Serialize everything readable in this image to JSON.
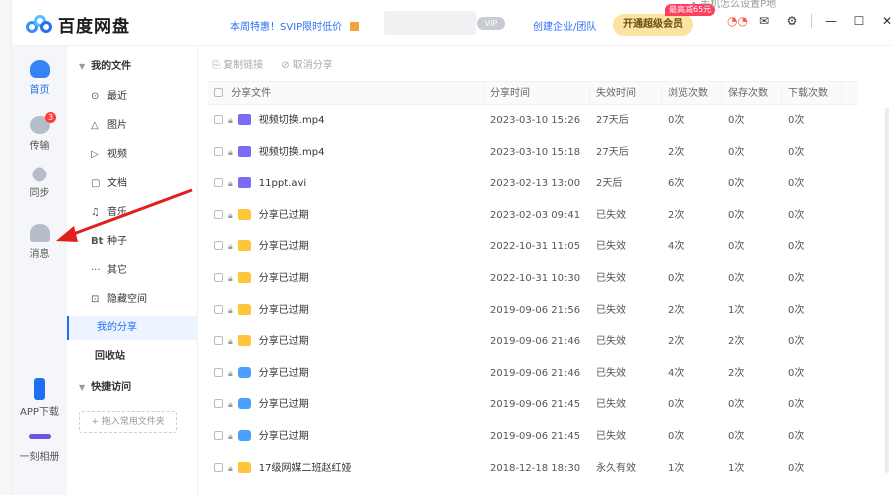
{
  "app": {
    "title": "百度网盘"
  },
  "header": {
    "promo": "本周特惠！SVIP限时低价",
    "vip_badge": "VIP",
    "enterprise": "创建企业/团队",
    "open_vip": "开通超级会员",
    "discount": "最高减65元",
    "hint": "• 手机怎么设置P地",
    "icons": [
      "game-icon",
      "mail-icon",
      "settings-icon",
      "minimize-icon",
      "maximize-icon",
      "close-icon"
    ]
  },
  "rail": [
    {
      "label": "首页",
      "icon": "home-icon",
      "active": true
    },
    {
      "label": "传输",
      "icon": "transfer-icon",
      "badge": "3"
    },
    {
      "label": "同步",
      "icon": "sync-icon"
    },
    {
      "label": "消息",
      "icon": "message-icon"
    },
    {
      "label": "APP下载",
      "icon": "phone-icon"
    },
    {
      "label": "一刻相册",
      "icon": "album-icon"
    }
  ],
  "nav": {
    "my_files": "我的文件",
    "items": [
      {
        "label": "最近",
        "icon": "⊙"
      },
      {
        "label": "图片",
        "icon": "△"
      },
      {
        "label": "视频",
        "icon": "▷"
      },
      {
        "label": "文档",
        "icon": "▢"
      },
      {
        "label": "音乐",
        "icon": "♫"
      },
      {
        "label": "种子",
        "icon": "Bt"
      },
      {
        "label": "其它",
        "icon": "···"
      },
      {
        "label": "隐藏空间",
        "icon": "⊡"
      }
    ],
    "my_share": "我的分享",
    "recycle": "回收站",
    "quick_access": "快捷访问",
    "add_folder": "+ 拖入常用文件夹"
  },
  "toolbar": {
    "copy_link": "复制链接",
    "cancel_share": "取消分享"
  },
  "table": {
    "headers": [
      "分享文件",
      "分享时间",
      "失效时间",
      "浏览次数",
      "保存次数",
      "下载次数"
    ],
    "rows": [
      {
        "icon": "video",
        "name": "视频切换.mp4",
        "time": "2023-03-10 15:26",
        "expire": "27天后",
        "views": "0次",
        "saves": "0次",
        "downloads": "0次"
      },
      {
        "icon": "video",
        "name": "视频切换.mp4",
        "time": "2023-03-10 15:18",
        "expire": "27天后",
        "views": "2次",
        "saves": "0次",
        "downloads": "0次"
      },
      {
        "icon": "video",
        "name": "11ppt.avi",
        "time": "2023-02-13 13:00",
        "expire": "2天后",
        "views": "6次",
        "saves": "0次",
        "downloads": "0次"
      },
      {
        "icon": "folder",
        "name": "分享已过期",
        "time": "2023-02-03 09:41",
        "expire": "已失效",
        "views": "2次",
        "saves": "0次",
        "downloads": "0次"
      },
      {
        "icon": "folder",
        "name": "分享已过期",
        "time": "2022-10-31 11:05",
        "expire": "已失效",
        "views": "4次",
        "saves": "0次",
        "downloads": "0次"
      },
      {
        "icon": "folder",
        "name": "分享已过期",
        "time": "2022-10-31 10:30",
        "expire": "已失效",
        "views": "0次",
        "saves": "0次",
        "downloads": "0次"
      },
      {
        "icon": "folder",
        "name": "分享已过期",
        "time": "2019-09-06 21:56",
        "expire": "已失效",
        "views": "2次",
        "saves": "1次",
        "downloads": "0次"
      },
      {
        "icon": "folder",
        "name": "分享已过期",
        "time": "2019-09-06 21:46",
        "expire": "已失效",
        "views": "2次",
        "saves": "2次",
        "downloads": "0次"
      },
      {
        "icon": "special",
        "name": "分享已过期",
        "time": "2019-09-06 21:46",
        "expire": "已失效",
        "views": "4次",
        "saves": "2次",
        "downloads": "0次"
      },
      {
        "icon": "special",
        "name": "分享已过期",
        "time": "2019-09-06 21:45",
        "expire": "已失效",
        "views": "0次",
        "saves": "0次",
        "downloads": "0次"
      },
      {
        "icon": "special",
        "name": "分享已过期",
        "time": "2019-09-06 21:45",
        "expire": "已失效",
        "views": "0次",
        "saves": "0次",
        "downloads": "0次"
      },
      {
        "icon": "folder",
        "name": "17级网媒二班赵红娅",
        "time": "2018-12-18 18:30",
        "expire": "永久有效",
        "views": "1次",
        "saves": "1次",
        "downloads": "0次"
      }
    ]
  },
  "colors": {
    "accent": "#1f6ff3",
    "annotation_arrow": "#e0201c"
  }
}
